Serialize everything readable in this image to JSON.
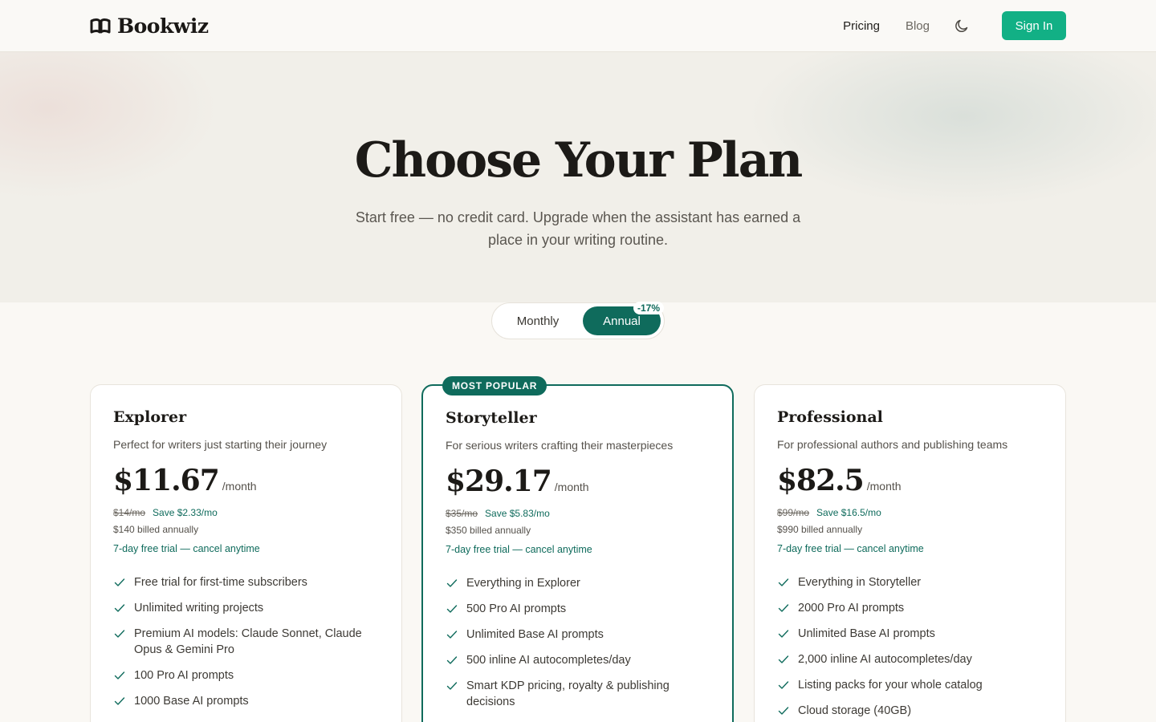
{
  "header": {
    "logo_text": "Bookwiz",
    "nav": {
      "pricing": "Pricing",
      "blog": "Blog"
    },
    "theme_icon": "moon-icon",
    "sign_in": "Sign In"
  },
  "hero": {
    "title": "Choose Your Plan",
    "subtitle": "Start free — no credit card. Upgrade when the assistant has earned a place in your writing routine."
  },
  "billing_toggle": {
    "monthly": "Monthly",
    "annual": "Annual",
    "selected": "Annual",
    "discount": "-17%"
  },
  "colors": {
    "accent": "#0f6b5c",
    "signin": "#12b085"
  },
  "plans": [
    {
      "name": "Explorer",
      "description": "Perfect for writers just starting their journey",
      "price": "$11.67",
      "per": "/month",
      "old_price": "$14/mo",
      "save": "Save $2.33/mo",
      "billed": "$140 billed annually",
      "trial": "7-day free trial — cancel anytime",
      "features": [
        "Free trial for first-time subscribers",
        "Unlimited writing projects",
        "Premium AI models: Claude Sonnet, Claude Opus & Gemini Pro",
        "100 Pro AI prompts",
        "1000 Base AI prompts"
      ]
    },
    {
      "name": "Storyteller",
      "badge": "MOST POPULAR",
      "description": "For serious writers crafting their masterpieces",
      "price": "$29.17",
      "per": "/month",
      "old_price": "$35/mo",
      "save": "Save $5.83/mo",
      "billed": "$350 billed annually",
      "trial": "7-day free trial — cancel anytime",
      "features": [
        "Everything in Explorer",
        "500 Pro AI prompts",
        "Unlimited Base AI prompts",
        "500 inline AI autocompletes/day",
        "Smart KDP pricing, royalty & publishing decisions"
      ]
    },
    {
      "name": "Professional",
      "description": "For professional authors and publishing teams",
      "price": "$82.5",
      "per": "/month",
      "old_price": "$99/mo",
      "save": "Save $16.5/mo",
      "billed": "$990 billed annually",
      "trial": "7-day free trial — cancel anytime",
      "features": [
        "Everything in Storyteller",
        "2000 Pro AI prompts",
        "Unlimited Base AI prompts",
        "2,000 inline AI autocompletes/day",
        "Listing packs for your whole catalog",
        "Cloud storage (40GB)"
      ]
    }
  ]
}
